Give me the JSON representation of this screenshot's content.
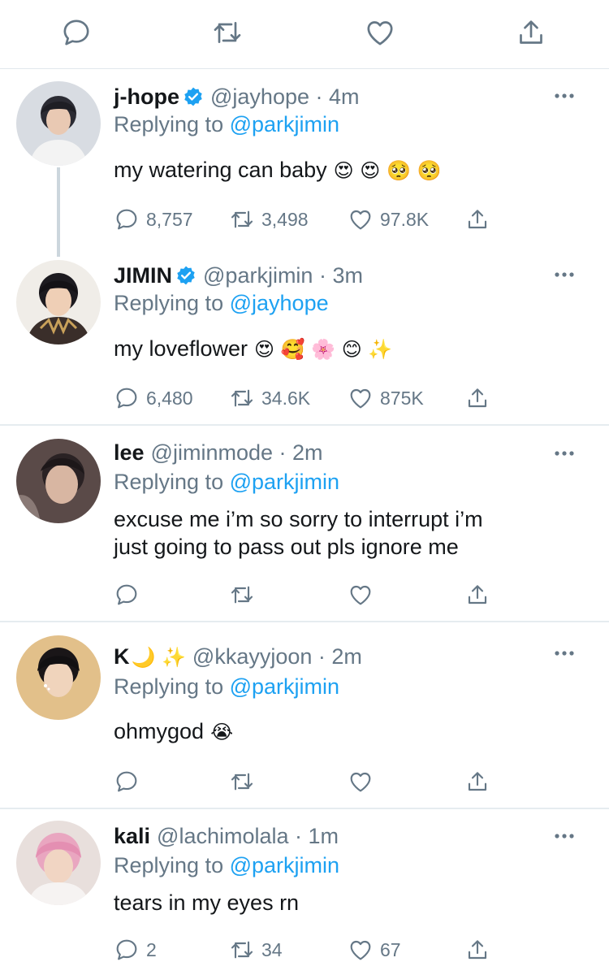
{
  "top_actions": [
    "reply-icon",
    "retweet-icon",
    "like-icon",
    "share-icon"
  ],
  "colors": {
    "link": "#1da1f2",
    "muted": "#657786",
    "text": "#14171a",
    "verified": "#1da1f2"
  },
  "tweets": [
    {
      "name": "j-hope",
      "verified": true,
      "handle": "@jayhope",
      "time": "· 4m",
      "replying_label": "Replying to",
      "replying_to": "@parkjimin",
      "text": [
        "my watering can baby"
      ],
      "emoji": "😍 😍 🥺 🥺",
      "replies": "8,757",
      "retweets": "3,498",
      "likes": "97.8K"
    },
    {
      "name": "JIMIN",
      "verified": true,
      "handle": "@parkjimin",
      "time": "· 3m",
      "replying_label": "Replying to",
      "replying_to": "@jayhope",
      "text": [
        "my loveflower"
      ],
      "emoji": "😍 🥰 🌸 😊 ✨",
      "replies": "6,480",
      "retweets": "34.6K",
      "likes": "875K"
    },
    {
      "name": "lee",
      "verified": false,
      "handle": "@jiminmode",
      "time": "· 2m",
      "replying_label": "Replying to",
      "replying_to": "@parkjimin",
      "text": [
        "excuse me i’m so sorry to interrupt i’m",
        "just going to pass out pls ignore me"
      ],
      "emoji": "",
      "replies": "",
      "retweets": "",
      "likes": ""
    },
    {
      "name": "K",
      "name_emoji": "🌙 ✨",
      "verified": false,
      "handle": "@kkayyjoon",
      "time": "· 2m",
      "replying_label": "Replying to",
      "replying_to": "@parkjimin",
      "text": [
        "ohmygod"
      ],
      "emoji": "😭",
      "replies": "",
      "retweets": "",
      "likes": ""
    },
    {
      "name": "kali",
      "verified": false,
      "handle": "@lachimolala",
      "time": "· 1m",
      "replying_label": "Replying to",
      "replying_to": "@parkjimin",
      "text": [
        "tears in my eyes rn"
      ],
      "emoji": "",
      "replies": "2",
      "retweets": "34",
      "likes": "67"
    }
  ]
}
